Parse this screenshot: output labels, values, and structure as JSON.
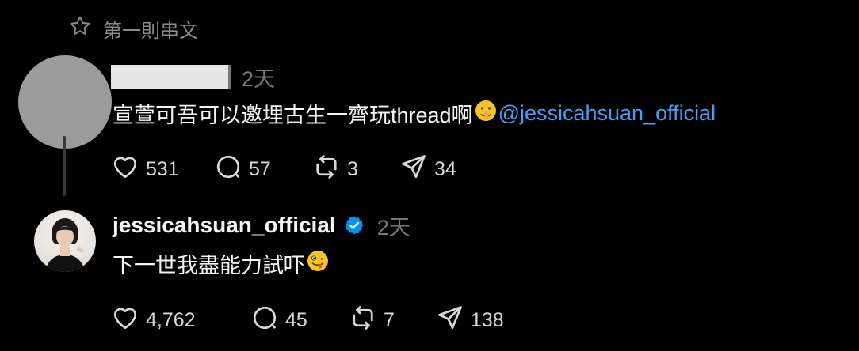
{
  "header": {
    "label": "第一則串文"
  },
  "post1": {
    "time": "2天",
    "text": "宣萱可吾可以邀埋古生一齊玩thread啊",
    "mention": "@jessicahsuan_official",
    "stats": {
      "likes": "531",
      "replies": "57",
      "reposts": "3",
      "shares": "34"
    }
  },
  "post2": {
    "username": "jessicahsuan_official",
    "time": "2天",
    "text": "下一世我盡能力試吓",
    "stats": {
      "likes": "4,762",
      "replies": "45",
      "reposts": "7",
      "shares": "138"
    }
  },
  "icons": {
    "star": "star-icon",
    "like": "heart-icon",
    "reply": "comment-icon",
    "repost": "repost-icon",
    "share": "send-icon",
    "verified": "verified-badge-icon"
  },
  "colors": {
    "background": "#000000",
    "mention": "#4a9ef5",
    "verified": "#0095f6"
  }
}
